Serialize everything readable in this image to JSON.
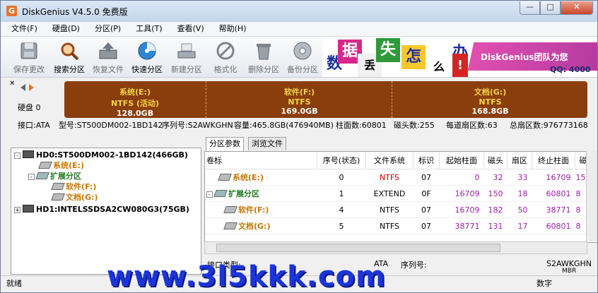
{
  "window": {
    "title": "DiskGenius V4.5.0 免费版",
    "app_icon_letter": "G",
    "controls": {
      "minimize": "—",
      "maximize": "□",
      "close": "✕"
    }
  },
  "menu": [
    "文件(F)",
    "硬盘(D)",
    "分区(P)",
    "工具(T)",
    "查看(V)",
    "帮助(H)"
  ],
  "toolbar": [
    {
      "label": "保存更改",
      "icon": "save-icon"
    },
    {
      "label": "搜索分区",
      "icon": "search-partition-icon"
    },
    {
      "label": "恢复文件",
      "icon": "restore-file-icon"
    },
    {
      "label": "快速分区",
      "icon": "quick-partition-icon"
    },
    {
      "label": "新建分区",
      "icon": "new-partition-icon"
    },
    {
      "label": "格式化",
      "icon": "format-icon"
    },
    {
      "label": "删除分区",
      "icon": "delete-partition-icon"
    },
    {
      "label": "备份分区",
      "icon": "backup-partition-icon"
    }
  ],
  "banner": {
    "tiles": [
      "数",
      "据",
      "丢",
      "失",
      "怎",
      "么",
      "办",
      "!"
    ],
    "brand": "DiskGenius团队为您",
    "qq": "QQ: 4000"
  },
  "diskbar": {
    "disk_label": "硬盘 0",
    "partitions": [
      {
        "name": "系统(E:)",
        "fs": "NTFS (活动)",
        "size": "128.0GB"
      },
      {
        "name": "软件(F:)",
        "fs": "NTFS",
        "size": "169.0GB"
      },
      {
        "name": "文档(G:)",
        "fs": "NTFS",
        "size": "168.8GB"
      }
    ]
  },
  "info": {
    "interface": "接口:ATA",
    "model": "型号:ST500DM002-1BD142",
    "serial": "序列号:S2AWKGHN",
    "capacity": "容量:465.8GB(476940MB)",
    "cylinders": "柱面数:60801",
    "heads": "磁头数:255",
    "sectors_per_track": "每道扇区数:63",
    "total_sectors": "总扇区数:976773168"
  },
  "tree": [
    {
      "text": "HD0:ST500DM002-1BD142(466GB)",
      "type": "disk",
      "expander": "-"
    },
    {
      "text": "系统(E:)",
      "type": "volume",
      "expander": ""
    },
    {
      "text": "扩展分区",
      "type": "extended",
      "expander": "-"
    },
    {
      "text": "软件(F:)",
      "type": "volume",
      "expander": ""
    },
    {
      "text": "文档(G:)",
      "type": "volume",
      "expander": ""
    },
    {
      "text": "HD1:INTELSSDSA2CW080G3(75GB)",
      "type": "disk",
      "expander": "+"
    }
  ],
  "tabs": [
    "分区参数",
    "浏览文件"
  ],
  "table": {
    "columns": [
      "卷标",
      "序号(状态)",
      "文件系统",
      "标识",
      "起始柱面",
      "磁头",
      "扇区",
      "终止柱面",
      "磁"
    ],
    "rows": [
      {
        "label": "系统(E:)",
        "index": "0",
        "fs": "NTFS",
        "id": "07",
        "start_cyl": "0",
        "head": "32",
        "sector": "33",
        "end_cyl": "16709",
        "extra": "15"
      },
      {
        "label": "扩展分区",
        "index": "1",
        "fs": "EXTEND",
        "id": "0F",
        "start_cyl": "16709",
        "head": "150",
        "sector": "18",
        "end_cyl": "60801",
        "extra": "8"
      },
      {
        "label": "软件(F:)",
        "index": "4",
        "fs": "NTFS",
        "id": "07",
        "start_cyl": "16709",
        "head": "182",
        "sector": "50",
        "end_cyl": "38771",
        "extra": "8"
      },
      {
        "label": "文档(G:)",
        "index": "5",
        "fs": "NTFS",
        "id": "07",
        "start_cyl": "38771",
        "head": "131",
        "sector": "17",
        "end_cyl": "60801",
        "extra": "8"
      }
    ]
  },
  "detail": {
    "interface_type_label": "接口类型:",
    "interface_type_value": "ATA",
    "serial_label": "序列号:",
    "serial_value": "S2AWKGHN",
    "extra_value": "MBR"
  },
  "status": {
    "left": "就绪",
    "right": "数字"
  },
  "watermark": "www.3l5kkk.com",
  "colors": {
    "partition_bar": "#8a3e0c",
    "partition_name": "#f6d34a",
    "tree_volume": "#c87800",
    "tree_extended": "#1f7a1f",
    "fs_red": "#cc0000",
    "watermark": "#1a35d8"
  }
}
